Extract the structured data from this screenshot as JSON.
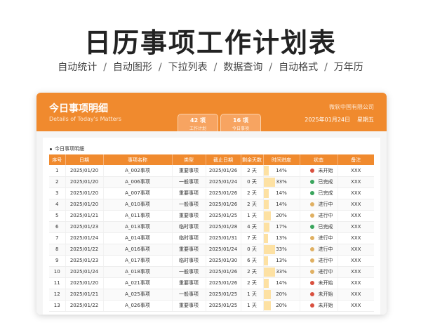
{
  "hero": {
    "title": "日历事项工作计划表",
    "features": [
      "自动统计",
      "自动图形",
      "下拉列表",
      "数据查询",
      "自动格式",
      "万年历"
    ],
    "separator": "/"
  },
  "card": {
    "title": "今日事项明细",
    "subtitle": "Details of Today's Matters",
    "company": "微软中国有限公司",
    "date": "2025年01月24日",
    "weekday": "星期五",
    "stats": [
      {
        "value": "42 项",
        "label": "工作计划"
      },
      {
        "value": "16 项",
        "label": "今日事项"
      }
    ],
    "panel_title": "今日事项明细"
  },
  "table": {
    "headers": [
      "序号",
      "日期",
      "事项名称",
      "类型",
      "截止日期",
      "剩余天数",
      "时间进度",
      "状态",
      "备注"
    ],
    "rows": [
      {
        "no": "1",
        "date": "2025/01/20",
        "name": "A_002事项",
        "type": "重要事项",
        "deadline": "2025/01/26",
        "remain": "2 天",
        "progress": "14%",
        "progress_value": 0.14,
        "status": "未开始",
        "status_icon": "x-circle-icon",
        "note": "XXX"
      },
      {
        "no": "2",
        "date": "2025/01/20",
        "name": "A_006事项",
        "type": "一般事项",
        "deadline": "2025/01/24",
        "remain": "0 天",
        "progress": "33%",
        "progress_value": 0.33,
        "status": "已完成",
        "status_icon": "check-circle-icon",
        "note": "XXX"
      },
      {
        "no": "3",
        "date": "2025/01/20",
        "name": "A_007事项",
        "type": "重要事项",
        "deadline": "2025/01/26",
        "remain": "2 天",
        "progress": "14%",
        "progress_value": 0.14,
        "status": "已完成",
        "status_icon": "check-circle-icon",
        "note": "XXX"
      },
      {
        "no": "4",
        "date": "2025/01/20",
        "name": "A_010事项",
        "type": "一般事项",
        "deadline": "2025/01/26",
        "remain": "2 天",
        "progress": "14%",
        "progress_value": 0.14,
        "status": "进行中",
        "status_icon": "progress-circle-icon",
        "note": "XXX"
      },
      {
        "no": "5",
        "date": "2025/01/21",
        "name": "A_011事项",
        "type": "重要事项",
        "deadline": "2025/01/25",
        "remain": "1 天",
        "progress": "20%",
        "progress_value": 0.2,
        "status": "进行中",
        "status_icon": "progress-circle-icon",
        "note": "XXX"
      },
      {
        "no": "6",
        "date": "2025/01/23",
        "name": "A_013事项",
        "type": "临时事项",
        "deadline": "2025/01/28",
        "remain": "4 天",
        "progress": "17%",
        "progress_value": 0.17,
        "status": "已完成",
        "status_icon": "check-circle-icon",
        "note": "XXX"
      },
      {
        "no": "7",
        "date": "2025/01/24",
        "name": "A_014事项",
        "type": "临时事项",
        "deadline": "2025/01/31",
        "remain": "7 天",
        "progress": "13%",
        "progress_value": 0.13,
        "status": "进行中",
        "status_icon": "progress-circle-icon",
        "note": "XXX"
      },
      {
        "no": "8",
        "date": "2025/01/22",
        "name": "A_016事项",
        "type": "重要事项",
        "deadline": "2025/01/24",
        "remain": "0 天",
        "progress": "33%",
        "progress_value": 0.33,
        "status": "进行中",
        "status_icon": "progress-circle-icon",
        "note": "XXX"
      },
      {
        "no": "9",
        "date": "2025/01/23",
        "name": "A_017事项",
        "type": "临时事项",
        "deadline": "2025/01/30",
        "remain": "6 天",
        "progress": "13%",
        "progress_value": 0.13,
        "status": "进行中",
        "status_icon": "progress-circle-icon",
        "note": "XXX"
      },
      {
        "no": "10",
        "date": "2025/01/24",
        "name": "A_018事项",
        "type": "一般事项",
        "deadline": "2025/01/26",
        "remain": "2 天",
        "progress": "33%",
        "progress_value": 0.33,
        "status": "进行中",
        "status_icon": "progress-circle-icon",
        "note": "XXX"
      },
      {
        "no": "11",
        "date": "2025/01/20",
        "name": "A_021事项",
        "type": "重要事项",
        "deadline": "2025/01/26",
        "remain": "2 天",
        "progress": "14%",
        "progress_value": 0.14,
        "status": "未开始",
        "status_icon": "x-circle-icon",
        "note": "XXX"
      },
      {
        "no": "12",
        "date": "2025/01/21",
        "name": "A_025事项",
        "type": "一般事项",
        "deadline": "2025/01/25",
        "remain": "1 天",
        "progress": "20%",
        "progress_value": 0.2,
        "status": "未开始",
        "status_icon": "x-circle-icon",
        "note": "XXX"
      },
      {
        "no": "13",
        "date": "2025/01/22",
        "name": "A_026事项",
        "type": "重要事项",
        "deadline": "2025/01/25",
        "remain": "1 天",
        "progress": "20%",
        "progress_value": 0.2,
        "status": "未开始",
        "status_icon": "x-circle-icon",
        "note": "XXX"
      }
    ]
  },
  "colors": {
    "accent": "#f08a2e",
    "progress_fill": "#fde1a3",
    "status_done": "#3aa55d",
    "status_progress": "#e0b062",
    "status_not_started": "#d9503f"
  }
}
